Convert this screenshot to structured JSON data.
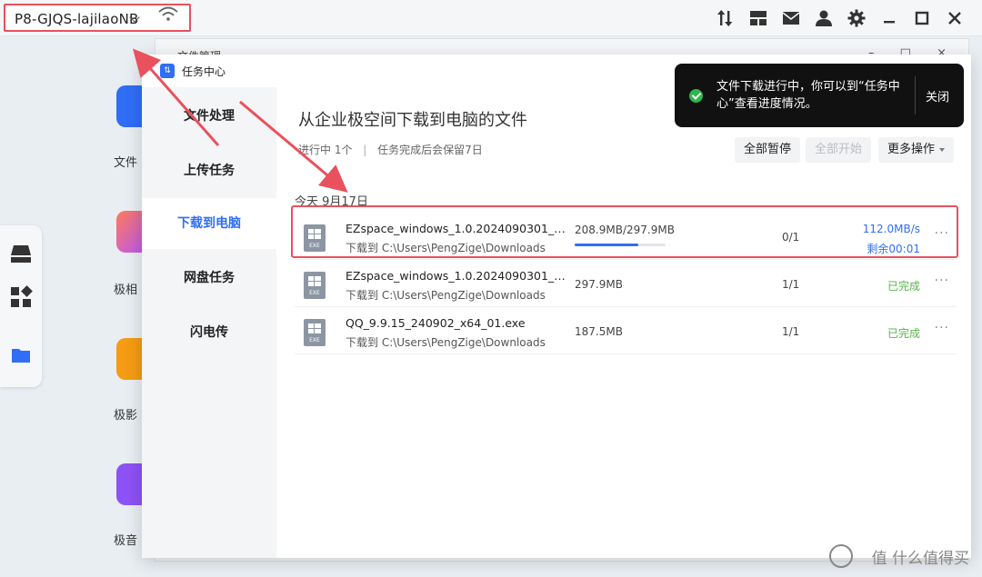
{
  "topbar": {
    "device_name": "P8-GJQS-lajilaoNB",
    "icons": [
      "transfer-icon",
      "layout-icon",
      "mail-icon",
      "user-icon",
      "gear-icon",
      "minimize-icon",
      "maximize-icon",
      "close-icon"
    ]
  },
  "desktop": {
    "labels": [
      "文件",
      "极相",
      "极影",
      "极音"
    ]
  },
  "back_window": {
    "title": "文件管理"
  },
  "task_window": {
    "title": "任务中心",
    "sidebar": [
      {
        "label": "文件处理"
      },
      {
        "label": "上传任务"
      },
      {
        "label": "下载到电脑"
      },
      {
        "label": "网盘任务"
      },
      {
        "label": "闪电传"
      }
    ],
    "active_index": 2,
    "main": {
      "title": "从企业极空间下载到电脑的文件",
      "status": "进行中 1个",
      "separator": "|",
      "retention": "任务完成后会保留7日",
      "pause_all": "全部暂停",
      "start_all": "全部开始",
      "more_actions": "更多操作",
      "date_label": "今天 9月17日"
    },
    "rows": [
      {
        "name": "EZspace_windows_1.0.2024090301_09...",
        "path": "下载到 C:\\Users\\PengZige\\Downloads",
        "size": "208.9MB/297.9MB",
        "progress": 0.7,
        "count": "0/1",
        "speed": "112.0MB/s",
        "remaining": "剩余00:01",
        "ext": "EXE"
      },
      {
        "name": "EZspace_windows_1.0.2024090301_09...",
        "path": "下载到 C:\\Users\\PengZige\\Downloads",
        "size": "297.9MB",
        "count": "1/1",
        "status": "已完成",
        "ext": "EXE"
      },
      {
        "name": "QQ_9.9.15_240902_x64_01.exe",
        "path": "下载到 C:\\Users\\PengZige\\Downloads",
        "size": "187.5MB",
        "count": "1/1",
        "status": "已完成",
        "ext": "EXE"
      }
    ],
    "more_glyph": "···"
  },
  "toast": {
    "message": "文件下载进行中，你可以到“任务中心”查看进度情况。",
    "close": "关闭"
  },
  "watermark": "值 什么值得买",
  "colors": {
    "accent": "#2f6ef5",
    "success": "#56b34a",
    "annotation": "#e8515d",
    "toast_bg": "#111111"
  }
}
